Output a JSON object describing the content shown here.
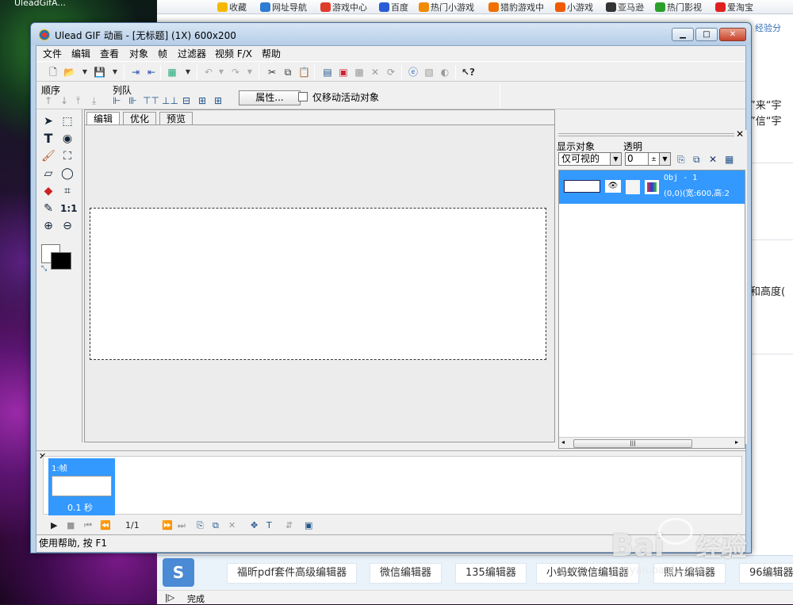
{
  "desktop": {
    "label": "UleadGifA..."
  },
  "browser": {
    "bookmarks": [
      {
        "label": "收藏",
        "color": "#f5b800"
      },
      {
        "label": "网址导航",
        "color": "#2d7bd2"
      },
      {
        "label": "游戏中心",
        "color": "#e03c2a"
      },
      {
        "label": "百度",
        "color": "#2a5cd6"
      },
      {
        "label": "热门小游戏",
        "color": "#f08a00"
      },
      {
        "label": "猎豹游戏中",
        "color": "#f07000"
      },
      {
        "label": "小游戏",
        "color": "#f05a00"
      },
      {
        "label": "亚马逊",
        "color": "#333333"
      },
      {
        "label": "热门影视",
        "color": "#2aa02a"
      },
      {
        "label": "爱淘宝",
        "color": "#e02020"
      }
    ],
    "crumb": "经验分",
    "right_texts": [
      "”来“宇",
      "”信“宇",
      "和高度(",
      "\u0018"
    ],
    "bottom_tools": [
      "福昕pdf套件高级编辑器",
      "微信编辑器",
      "135编辑器",
      "小蚂蚁微信编辑器",
      "照片编辑器",
      "96编辑器"
    ],
    "status": "完成"
  },
  "window": {
    "title": "Ulead GIF 动画 - [无标题] (1X) 600x200",
    "menu": [
      "文件",
      "编辑",
      "查看",
      "对象",
      "帧",
      "过滤器",
      "视频 F/X",
      "帮助"
    ],
    "toolbar2": {
      "order_label": "顺序",
      "queue_label": "列队",
      "properties_btn": "属性...",
      "move_active_only": "仅移动活动对象"
    },
    "tabs": [
      "编辑",
      "优化",
      "预览"
    ],
    "object_manager": {
      "show_label": "显示对象",
      "trans_label": "透明",
      "show_value": "仅可视的",
      "trans_value": "0",
      "obj_name": "Obj - 1",
      "obj_info": "(0,0)(宽:600,高:2"
    },
    "frames": {
      "frame_label": "1:帧",
      "frame_delay": "0.1 秒",
      "counter": "1/1"
    },
    "status": "使用帮助, 按 F1"
  },
  "watermark": {
    "brand": "Bai",
    "brand2": "经验",
    "url": "jingyan.baidu.com"
  }
}
